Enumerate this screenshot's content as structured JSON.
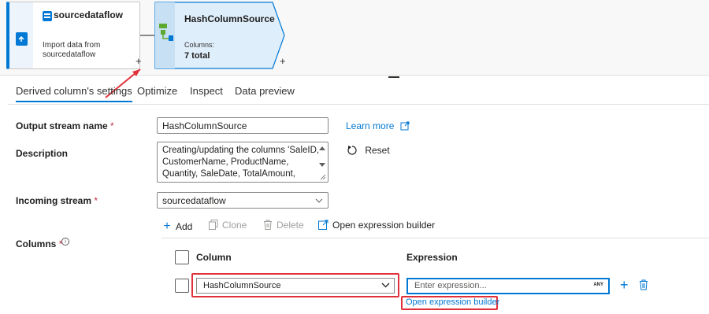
{
  "canvas": {
    "source_node": {
      "title": "sourcedataflow",
      "description": "Import data from sourcedataflow"
    },
    "hash_node": {
      "title": "HashColumnSource",
      "columns_label": "Columns:",
      "columns_value": "7 total"
    },
    "add_glyph": "+"
  },
  "tabs": [
    {
      "label": "Derived column's settings",
      "active": true
    },
    {
      "label": "Optimize",
      "active": false
    },
    {
      "label": "Inspect",
      "active": false
    },
    {
      "label": "Data preview",
      "active": false
    }
  ],
  "form": {
    "output_stream": {
      "label": "Output stream name",
      "required_mark": "*",
      "value": "HashColumnSource"
    },
    "learn_more": "Learn more",
    "description": {
      "label": "Description",
      "value": "Creating/updating the columns 'SaleID, CustomerName, ProductName, Quantity, SaleDate, TotalAmount,"
    },
    "reset": "Reset",
    "incoming_stream": {
      "label": "Incoming stream",
      "required_mark": "*",
      "value": "sourcedataflow"
    },
    "columns_label": "Columns",
    "columns_required": "*",
    "info_glyph": "i"
  },
  "toolbar": {
    "add": "Add",
    "clone": "Clone",
    "delete": "Delete",
    "open_builder": "Open expression builder"
  },
  "grid": {
    "column_header": "Column",
    "expression_header": "Expression",
    "row": {
      "column_value": "HashColumnSource",
      "expression_placeholder": "Enter expression...",
      "any_badge": "ANY",
      "open_builder_link": "Open expression builder"
    }
  },
  "colors": {
    "accent": "#0078d4",
    "highlight": "#e0303a",
    "required": "#c4314b"
  }
}
